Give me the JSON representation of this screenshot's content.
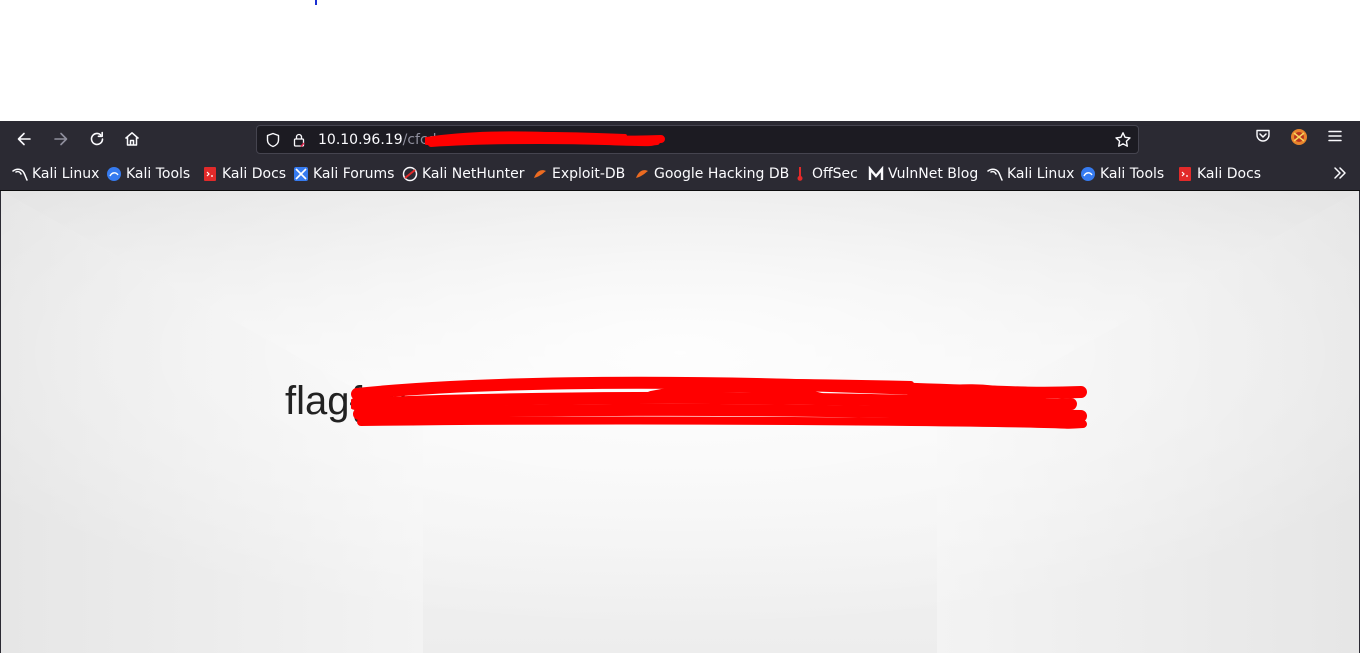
{
  "browser": {
    "url": {
      "host": "10.10.96.19",
      "path": "/cfcd"
    },
    "nav_icons": [
      "back-icon",
      "forward-icon",
      "reload-icon",
      "home-icon"
    ],
    "urlbar_icons": [
      "shield-icon",
      "lock-icon",
      "bookmark-star-icon"
    ],
    "right_icons": [
      "pocket-icon",
      "extension-icon",
      "menu-icon"
    ],
    "bookmarks": [
      {
        "label": "Kali Linux",
        "icon": "kali-dragon-icon"
      },
      {
        "label": "Kali Tools",
        "icon": "kali-tools-icon"
      },
      {
        "label": "Kali Docs",
        "icon": "kali-docs-icon"
      },
      {
        "label": "Kali Forums",
        "icon": "kali-forums-icon"
      },
      {
        "label": "Kali NetHunter",
        "icon": "nethunter-icon"
      },
      {
        "label": "Exploit-DB",
        "icon": "exploit-db-icon"
      },
      {
        "label": "Google Hacking DB",
        "icon": "ghdb-icon"
      },
      {
        "label": "OffSec",
        "icon": "offsec-icon"
      },
      {
        "label": "VulnNet Blog",
        "icon": "vulnnet-icon"
      },
      {
        "label": "Kali Linux",
        "icon": "kali-dragon-icon"
      },
      {
        "label": "Kali Tools",
        "icon": "kali-tools-icon"
      },
      {
        "label": "Kali Docs",
        "icon": "kali-docs-icon"
      }
    ],
    "overflow_icon": "chevron-double-right-icon"
  },
  "page": {
    "flag_text": "flag{                                                         e}",
    "background_color": "#ececec"
  },
  "colors": {
    "toolbar": "#2b2a33",
    "urlbar": "#1c1b22",
    "redaction": "#ff0000"
  }
}
